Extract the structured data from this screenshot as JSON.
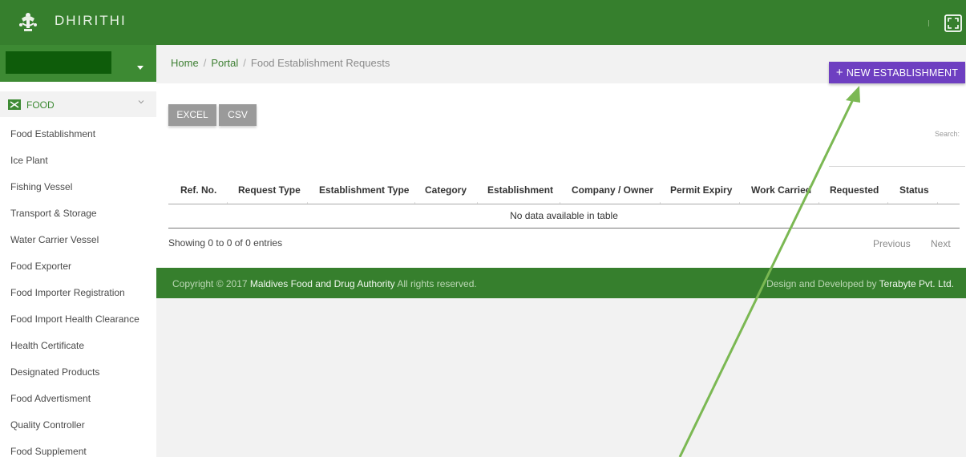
{
  "header": {
    "brand": "DHIRITHI"
  },
  "sidebar": {
    "section": {
      "label": "FOOD"
    },
    "items": [
      {
        "label": "Food Establishment"
      },
      {
        "label": "Ice Plant"
      },
      {
        "label": "Fishing Vessel"
      },
      {
        "label": "Transport & Storage"
      },
      {
        "label": "Water Carrier Vessel"
      },
      {
        "label": "Food Exporter"
      },
      {
        "label": "Food Importer Registration"
      },
      {
        "label": "Food Import Health Clearance"
      },
      {
        "label": "Health Certificate"
      },
      {
        "label": "Designated Products"
      },
      {
        "label": "Food Advertisment"
      },
      {
        "label": "Quality Controller"
      },
      {
        "label": "Food Supplement"
      }
    ]
  },
  "breadcrumb": {
    "home": "Home",
    "portal": "Portal",
    "current": "Food Establishment Requests",
    "separator": "/"
  },
  "actions": {
    "new_label": "NEW ESTABLISHMENT",
    "plus": "+"
  },
  "toolbar": {
    "excel": "EXCEL",
    "csv": "CSV"
  },
  "search": {
    "label": "Search:"
  },
  "table": {
    "columns": [
      "Ref. No.",
      "Request Type",
      "Establishment Type",
      "Category",
      "Establishment",
      "Company / Owner",
      "Permit Expiry",
      "Work Carried",
      "Requested",
      "Status"
    ],
    "empty_message": "No data available in table"
  },
  "pagination": {
    "info": "Showing 0 to 0 of 0 entries",
    "previous": "Previous",
    "next": "Next"
  },
  "footer": {
    "copyright_prefix": "Copyright © 2017 ",
    "org": "Maldives Food and Drug Authority",
    "rights": " All rights reserved.",
    "design_prefix": "Design and Developed by ",
    "company": "Terabyte Pvt. Ltd."
  },
  "colors": {
    "header_green": "#367f2d",
    "accent_purple": "#6e3fc1",
    "annotation_arrow": "#7bb853"
  }
}
